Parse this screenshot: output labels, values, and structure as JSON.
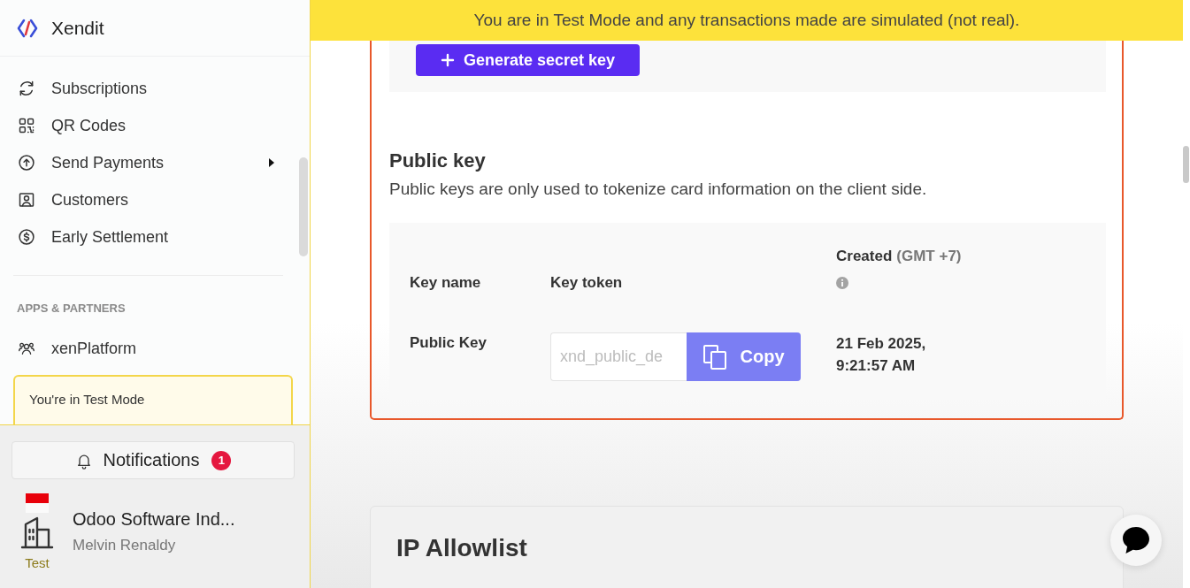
{
  "banner": {
    "text": "You are in Test Mode and any transactions made are simulated (not real)."
  },
  "sidebar": {
    "brand": "Xendit",
    "nav_items": [
      {
        "label": "Subscriptions",
        "has_submenu": false
      },
      {
        "label": "QR Codes",
        "has_submenu": false
      },
      {
        "label": "Send Payments",
        "has_submenu": true
      },
      {
        "label": "Customers",
        "has_submenu": false
      },
      {
        "label": "Early Settlement",
        "has_submenu": false
      }
    ],
    "section_label": "APPS & PARTNERS",
    "app_items": [
      {
        "label": "xenPlatform"
      }
    ],
    "test_mode_notice": "You're in Test Mode",
    "notifications": {
      "label": "Notifications",
      "count": "1"
    },
    "account": {
      "company": "Odoo Software Ind...",
      "user": "Melvin Renaldy",
      "mode": "Test"
    }
  },
  "secret_key": {
    "button": "Generate secret key"
  },
  "public_key": {
    "title": "Public key",
    "description": "Public keys are only used to tokenize card information on the client side.",
    "columns": [
      {
        "label": "Key name",
        "info": false
      },
      {
        "label": "Key token",
        "info": false
      },
      {
        "label": "Created",
        "note": "(GMT +7)",
        "info": true
      }
    ],
    "rows": [
      {
        "key_name": "Public Key",
        "token": "xnd_public_de",
        "copy_label": "Copy",
        "created": "21 Feb 2025, 9:21:57 AM"
      }
    ]
  },
  "ip_allowlist": {
    "title": "IP Allowlist"
  }
}
